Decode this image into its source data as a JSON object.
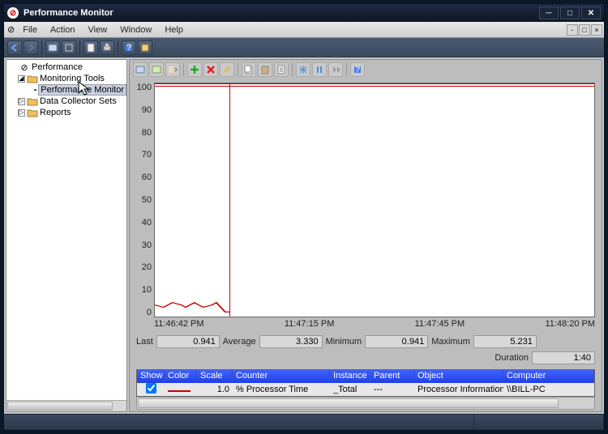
{
  "title": "Performance Monitor",
  "menus": {
    "file": "File",
    "action": "Action",
    "view": "View",
    "window": "Window",
    "help": "Help"
  },
  "tree": {
    "root": "Performance",
    "monitoring": "Monitoring Tools",
    "perfmon": "Performance Monitor",
    "dcs": "Data Collector Sets",
    "reports": "Reports"
  },
  "chart_data": {
    "type": "line",
    "ylim": [
      0,
      100
    ],
    "yticks": [
      100,
      90,
      80,
      70,
      60,
      50,
      40,
      30,
      20,
      10,
      0
    ],
    "xticks": [
      "11:46:42 PM",
      "11:47:15 PM",
      "11:47:45 PM",
      "11:48:20 PM"
    ],
    "cursor_pct": 17,
    "series": [
      {
        "name": "% Processor Time",
        "color": "#c00",
        "points": [
          [
            0,
            5
          ],
          [
            2,
            4
          ],
          [
            4,
            6
          ],
          [
            6,
            5
          ],
          [
            7,
            4
          ],
          [
            9,
            6
          ],
          [
            10,
            5
          ],
          [
            11,
            4
          ],
          [
            13,
            5
          ],
          [
            14,
            6
          ],
          [
            15,
            4
          ],
          [
            16,
            2
          ],
          [
            17,
            2
          ]
        ]
      }
    ]
  },
  "stats": {
    "last_l": "Last",
    "last_v": "0.941",
    "avg_l": "Average",
    "avg_v": "3.330",
    "min_l": "Minimum",
    "min_v": "0.941",
    "max_l": "Maximum",
    "max_v": "5.231",
    "dur_l": "Duration",
    "dur_v": "1:40"
  },
  "grid": {
    "head": {
      "show": "Show",
      "color": "Color",
      "scale": "Scale",
      "counter": "Counter",
      "instance": "Instance",
      "parent": "Parent",
      "object": "Object",
      "computer": "Computer"
    },
    "row": {
      "scale": "1.0",
      "counter": "% Processor Time",
      "instance": "_Total",
      "parent": "---",
      "object": "Processor Information",
      "computer": "\\\\BILL-PC"
    }
  }
}
